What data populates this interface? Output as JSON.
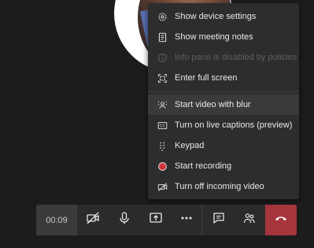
{
  "menu": {
    "items": [
      {
        "label": "Show device settings",
        "icon": "gear-icon"
      },
      {
        "label": "Show meeting notes",
        "icon": "notes-icon"
      },
      {
        "label": "Info pane is disabled by policies",
        "icon": "info-icon",
        "disabled": true
      },
      {
        "label": "Enter full screen",
        "icon": "fullscreen-icon"
      },
      {
        "label": "Start video with blur",
        "icon": "blur-icon",
        "hovered": true
      },
      {
        "label": "Turn on live captions (preview)",
        "icon": "cc-icon"
      },
      {
        "label": "Keypad",
        "icon": "keypad-icon"
      },
      {
        "label": "Start recording",
        "icon": "record-icon"
      },
      {
        "label": "Turn off incoming video",
        "icon": "video-off-icon"
      }
    ]
  },
  "toolbar": {
    "timer": "00:09",
    "buttons": [
      "video-off-icon",
      "microphone-icon",
      "share-screen-icon",
      "more-icon",
      "chat-icon",
      "participants-icon",
      "hang-up-icon"
    ]
  },
  "colors": {
    "background": "#1c1c1c",
    "menu_bg": "#2d2d2d",
    "hangup": "#a5343d",
    "record": "#d13438"
  }
}
